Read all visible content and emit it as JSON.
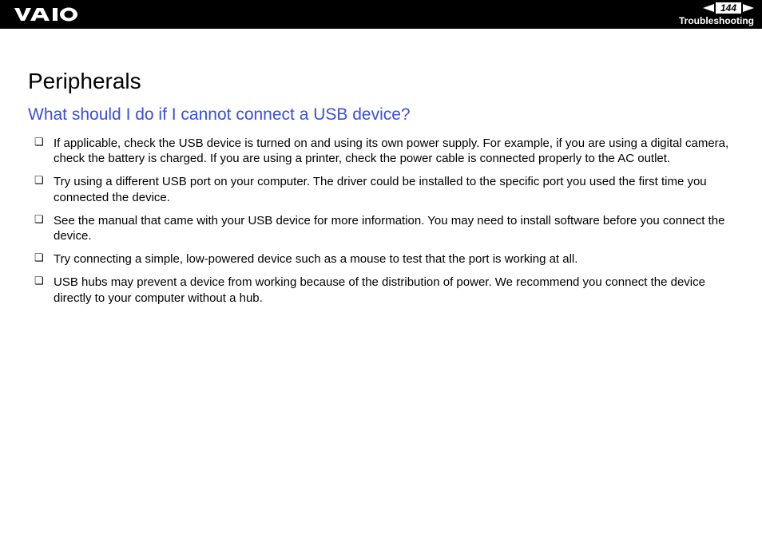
{
  "header": {
    "page_number": "144",
    "section": "Troubleshooting"
  },
  "content": {
    "title": "Peripherals",
    "question": "What should I do if I cannot connect a USB device?",
    "bullets": [
      "If applicable, check the USB device is turned on and using its own power supply. For example, if you are using a digital camera, check the battery is charged. If you are using a printer, check the power cable is connected properly to the AC outlet.",
      "Try using a different USB port on your computer. The driver could be installed to the specific port you used the first time you connected the device.",
      "See the manual that came with your USB device for more information. You may need to install software before you connect the device.",
      "Try connecting a simple, low-powered device such as a mouse to test that the port is working at all.",
      "USB hubs may prevent a device from working because of the distribution of power. We recommend you connect the device directly to your computer without a hub."
    ]
  }
}
